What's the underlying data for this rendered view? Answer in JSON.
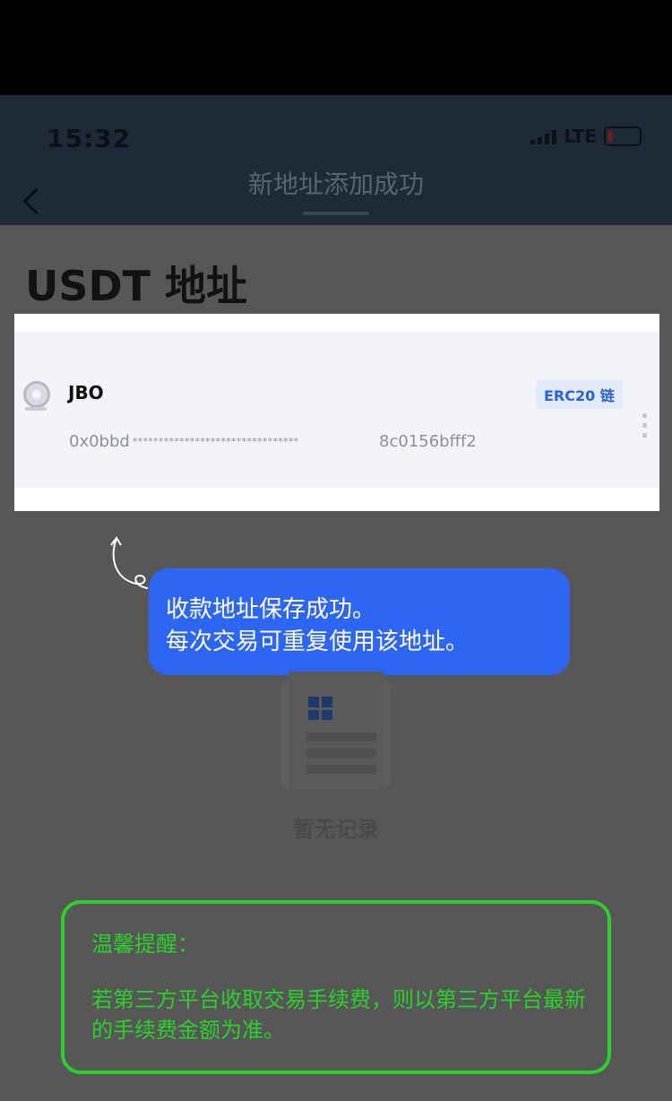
{
  "status_bar": {
    "time": "15:32",
    "network": "LTE"
  },
  "header": {
    "title": "新地址添加成功"
  },
  "page": {
    "heading": "USDT 地址"
  },
  "address_card": {
    "name": "JBO",
    "chain_badge": "ERC20 链",
    "address_prefix": "0x0bbd",
    "address_mask": "********************************",
    "address_suffix": "8c0156bfff2"
  },
  "tooltip": {
    "line1": "收款地址保存成功。",
    "line2": "每次交易可重复使用该地址。"
  },
  "empty_state": {
    "text": "暂无记录"
  },
  "reminder": {
    "title": "温馨提醒：",
    "body": "若第三方平台收取交易手续费，则以第三方平台最新的手续费金额为准。"
  },
  "colors": {
    "accent_blue": "#2d66f2",
    "reminder_green": "#2ad12a",
    "overlay": "#575757"
  },
  "icons": [
    "back-arrow-icon",
    "location-pin-icon",
    "more-vertical-icon",
    "grid-icon",
    "signal-icon",
    "battery-icon"
  ]
}
